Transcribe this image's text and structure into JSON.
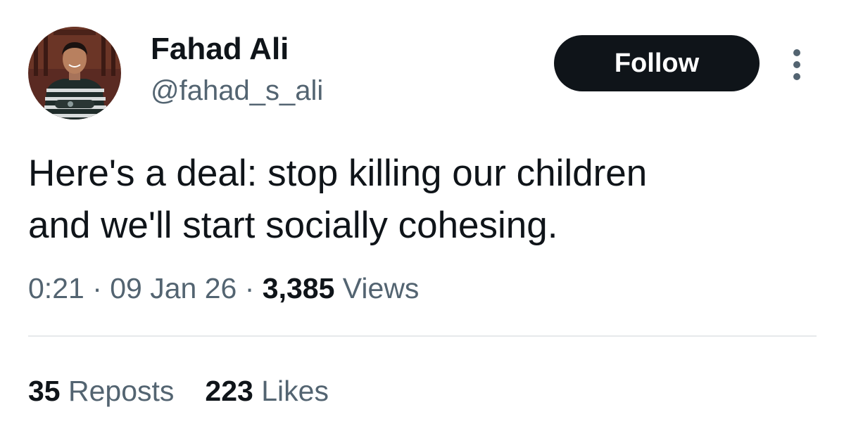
{
  "author": {
    "display_name": "Fahad Ali",
    "handle": "@fahad_s_ali",
    "avatar": "profile-photo"
  },
  "actions": {
    "follow_label": "Follow",
    "more_icon": "more-vertical-icon"
  },
  "tweet": {
    "text_lines": [
      "Here's a deal: stop killing our children",
      "and we'll start socially cohesing."
    ]
  },
  "meta": {
    "time": "0:21",
    "separator": " · ",
    "date": "09 Jan 26",
    "views_count": "3,385",
    "views_label": " Views"
  },
  "stats": {
    "reposts_count": "35",
    "reposts_label": " Reposts",
    "likes_count": "223",
    "likes_label": " Likes"
  },
  "colors": {
    "primary_text": "#0f1419",
    "secondary_text": "#536471",
    "button_bg": "#0f1419",
    "divider": "#e6e9eb"
  }
}
